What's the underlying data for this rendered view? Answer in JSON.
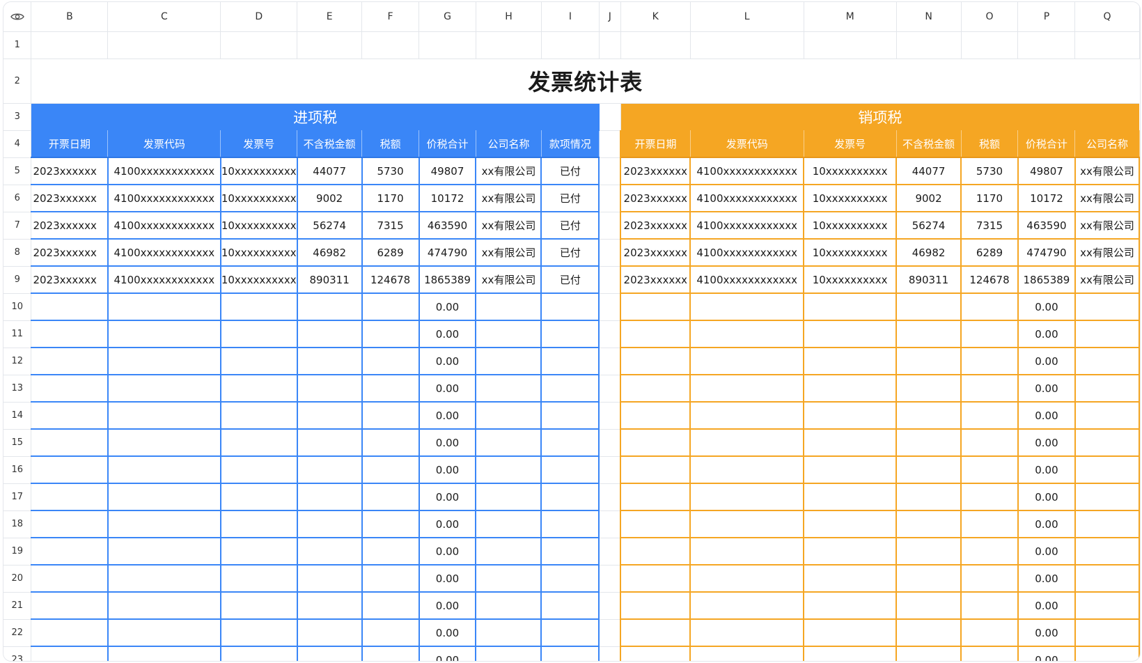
{
  "columns": [
    "B",
    "C",
    "D",
    "E",
    "F",
    "G",
    "H",
    "I",
    "J",
    "K",
    "L",
    "M",
    "N",
    "O",
    "P",
    "Q"
  ],
  "row_numbers": [
    "1",
    "2",
    "3",
    "4",
    "5",
    "6",
    "7",
    "8",
    "9",
    "10",
    "11",
    "12",
    "13",
    "14",
    "15",
    "16",
    "17",
    "18",
    "19",
    "20",
    "21",
    "22",
    "23"
  ],
  "title": "发票统计表",
  "input_section": {
    "label": "进项税",
    "headers": [
      "开票日期",
      "发票代码",
      "发票号",
      "不含税金额",
      "税额",
      "价税合计",
      "公司名称",
      "款项情况"
    ],
    "rows": [
      [
        "2023xxxxxx",
        "4100xxxxxxxxxxxx",
        "10xxxxxxxxxx",
        "44077",
        "5730",
        "49807",
        "xx有限公司",
        "已付"
      ],
      [
        "2023xxxxxx",
        "4100xxxxxxxxxxxx",
        "10xxxxxxxxxx",
        "9002",
        "1170",
        "10172",
        "xx有限公司",
        "已付"
      ],
      [
        "2023xxxxxx",
        "4100xxxxxxxxxxxx",
        "10xxxxxxxxxx",
        "56274",
        "7315",
        "463590",
        "xx有限公司",
        "已付"
      ],
      [
        "2023xxxxxx",
        "4100xxxxxxxxxxxx",
        "10xxxxxxxxxx",
        "46982",
        "6289",
        "474790",
        "xx有限公司",
        "已付"
      ],
      [
        "2023xxxxxx",
        "4100xxxxxxxxxxxx",
        "10xxxxxxxxxx",
        "890311",
        "124678",
        "1865389",
        "xx有限公司",
        "已付"
      ]
    ]
  },
  "output_section": {
    "label": "销项税",
    "headers": [
      "开票日期",
      "发票代码",
      "发票号",
      "不含税金额",
      "税额",
      "价税合计",
      "公司名称"
    ],
    "rows": [
      [
        "2023xxxxxx",
        "4100xxxxxxxxxxxx",
        "10xxxxxxxxxx",
        "44077",
        "5730",
        "49807",
        "xx有限公司"
      ],
      [
        "2023xxxxxx",
        "4100xxxxxxxxxxxx",
        "10xxxxxxxxxx",
        "9002",
        "1170",
        "10172",
        "xx有限公司"
      ],
      [
        "2023xxxxxx",
        "4100xxxxxxxxxxxx",
        "10xxxxxxxxxx",
        "56274",
        "7315",
        "463590",
        "xx有限公司"
      ],
      [
        "2023xxxxxx",
        "4100xxxxxxxxxxxx",
        "10xxxxxxxxxx",
        "46982",
        "6289",
        "474790",
        "xx有限公司"
      ],
      [
        "2023xxxxxx",
        "4100xxxxxxxxxxxx",
        "10xxxxxxxxxx",
        "890311",
        "124678",
        "1865389",
        "xx有限公司"
      ]
    ]
  },
  "empty_total_value": "0.00",
  "colors": {
    "input_accent": "#3a86f7",
    "output_accent": "#f5a623",
    "grid": "#e3e6eb"
  },
  "icons": {
    "corner": "eye-icon"
  }
}
